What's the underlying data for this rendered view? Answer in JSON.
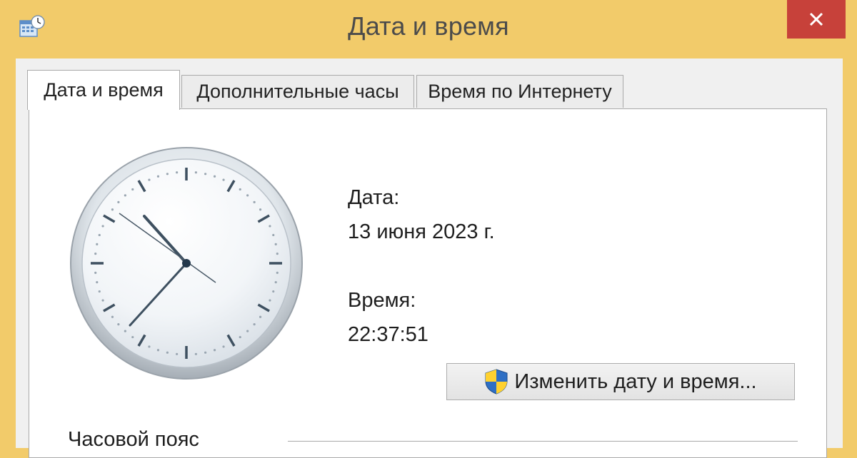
{
  "window": {
    "title": "Дата и время",
    "icon": "calendar-clock-icon",
    "close_icon": "close-icon"
  },
  "tabs": [
    {
      "label": "Дата и время",
      "active": true
    },
    {
      "label": "Дополнительные часы",
      "active": false
    },
    {
      "label": "Время по Интернету",
      "active": false
    }
  ],
  "datetime": {
    "date_label": "Дата:",
    "date_value": "13 июня 2023 г.",
    "time_label": "Время:",
    "time_value": "22:37:51"
  },
  "change_button": {
    "label": "Изменить дату и время...",
    "icon": "uac-shield-icon"
  },
  "timezone": {
    "section_label": "Часовой пояс"
  },
  "colors": {
    "title_bar": "#f2cb6a",
    "close_button": "#c7413a"
  }
}
